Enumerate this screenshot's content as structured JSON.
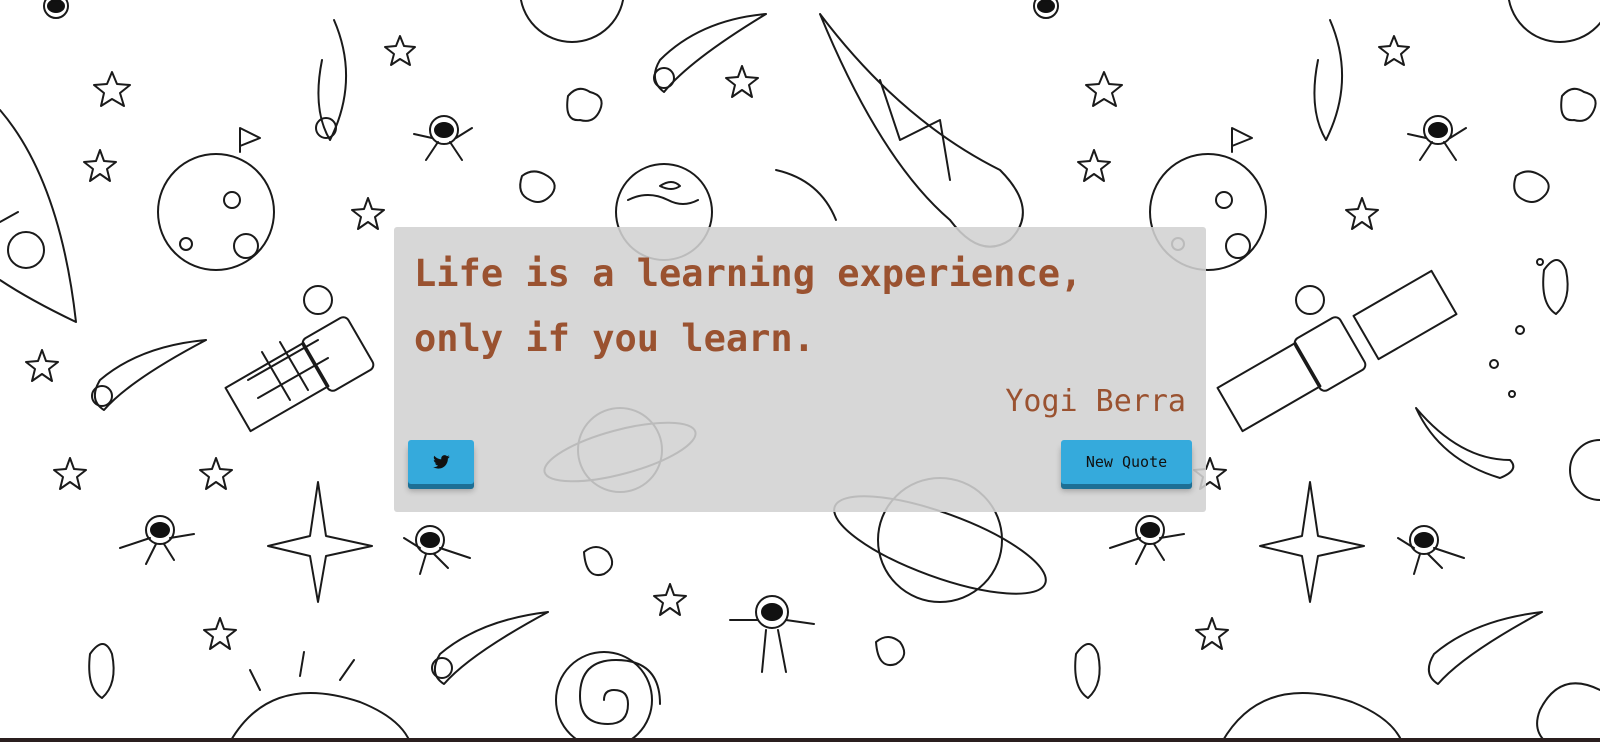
{
  "quote": {
    "text": "Life is a learning experience, only if you learn.",
    "author": "Yogi Berra"
  },
  "buttons": {
    "tweet_icon": "twitter-icon",
    "new_quote_label": "New Quote"
  },
  "colors": {
    "quote_text": "#9a5230",
    "button_bg": "#35aadc",
    "box_bg": "#d2d2d2"
  }
}
